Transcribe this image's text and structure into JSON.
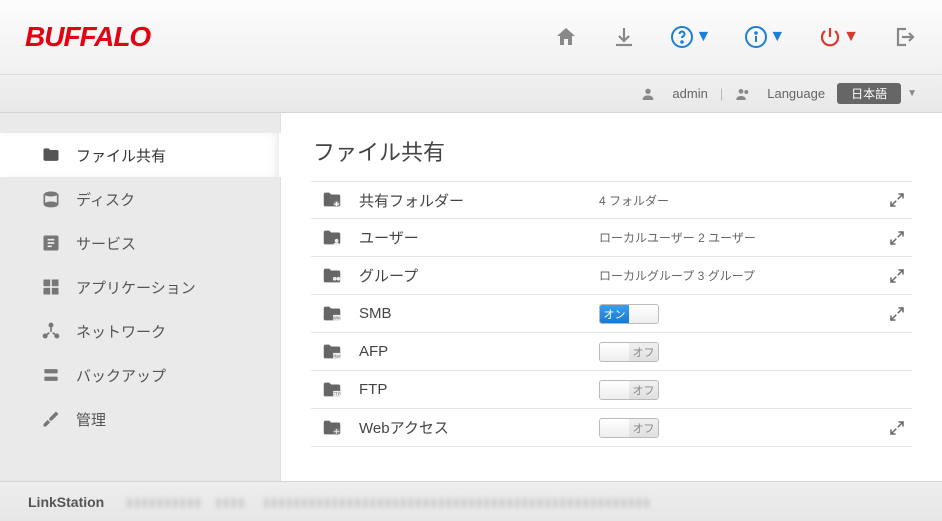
{
  "brand": "BUFFALO",
  "footer_brand": "LinkStation",
  "subheader": {
    "user": "admin",
    "language_label": "Language",
    "language_value": "日本語"
  },
  "sidebar": {
    "items": [
      {
        "label": "ファイル共有"
      },
      {
        "label": "ディスク"
      },
      {
        "label": "サービス"
      },
      {
        "label": "アプリケーション"
      },
      {
        "label": "ネットワーク"
      },
      {
        "label": "バックアップ"
      },
      {
        "label": "管理"
      }
    ]
  },
  "main": {
    "title": "ファイル共有",
    "rows": [
      {
        "label": "共有フォルダー",
        "status": "4 フォルダー",
        "has_expand": true,
        "type": "text"
      },
      {
        "label": "ユーザー",
        "status": "ローカルユーザー 2 ユーザー",
        "has_expand": true,
        "type": "text"
      },
      {
        "label": "グループ",
        "status": "ローカルグループ 3 グループ",
        "has_expand": true,
        "type": "text"
      },
      {
        "label": "SMB",
        "has_expand": true,
        "type": "toggle",
        "toggle": "on"
      },
      {
        "label": "AFP",
        "has_expand": false,
        "type": "toggle",
        "toggle": "off"
      },
      {
        "label": "FTP",
        "has_expand": false,
        "type": "toggle",
        "toggle": "off"
      },
      {
        "label": "Webアクセス",
        "has_expand": true,
        "type": "toggle",
        "toggle": "off"
      }
    ]
  },
  "toggle_labels": {
    "on": "オン",
    "off": "オフ"
  }
}
